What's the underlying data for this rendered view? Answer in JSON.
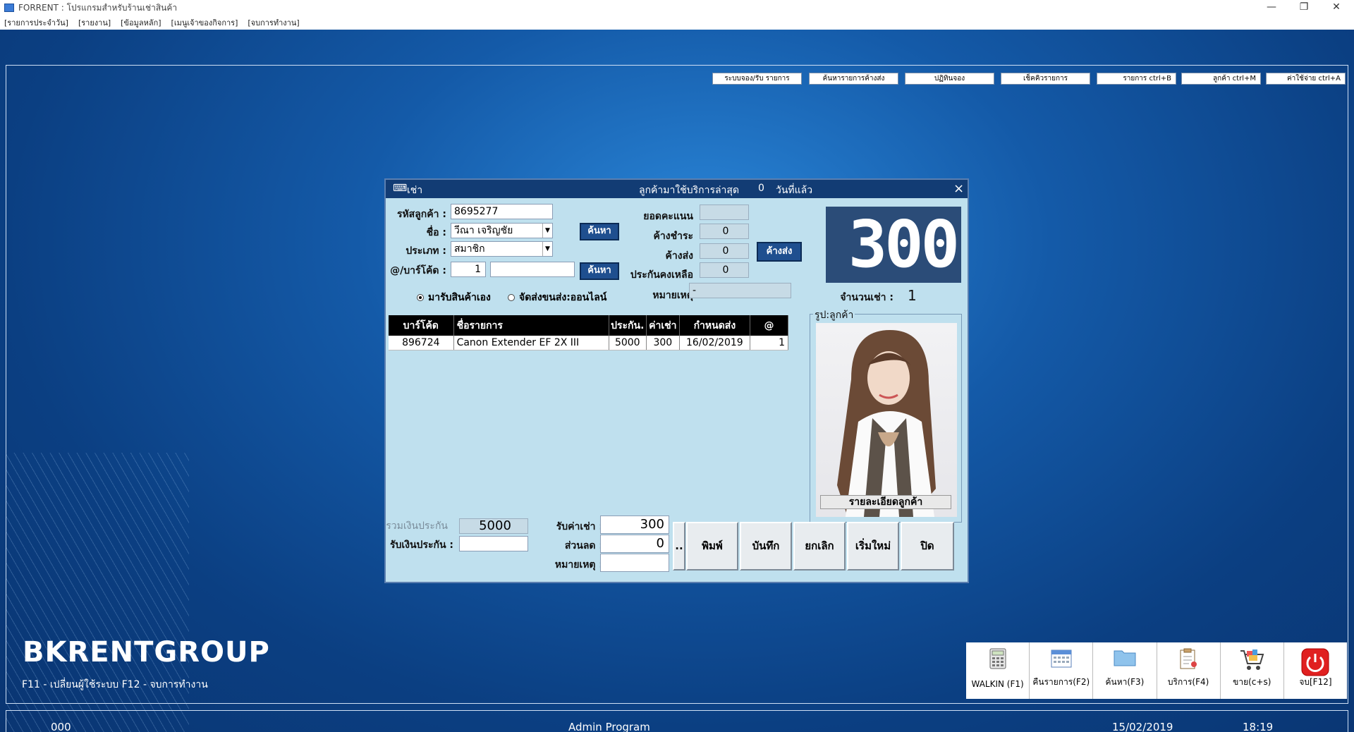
{
  "window": {
    "title": "FORRENT : โปรแกรมสำหรับร้านเช่าสินค้า",
    "minimize": "—",
    "restore": "❐",
    "close": "✕"
  },
  "menu": [
    "[รายการประจำวัน]",
    "[รายงาน]",
    "[ข้อมูลหลัก]",
    "[เมนูเจ้าของกิจการ]",
    "[จบการทำงาน]"
  ],
  "top_buttons": [
    "ระบบจอง/รับ รายการ",
    "ค้นหารายการค้างส่ง",
    "ปฏิทินจอง",
    "เช็คคิวรายการ",
    "รายการ ctrl+B",
    "ลูกค้า ctrl+M",
    "ค่าใช้จ่าย ctrl+A"
  ],
  "brand": {
    "name": "BKRENTGROUP",
    "hotkeys": "F11 - เปลี่ยนผู้ใช้ระบบ    F12 - จบการทำงาน"
  },
  "status": {
    "code": "000",
    "user": "Admin Program",
    "date": "15/02/2019",
    "time": "18:19"
  },
  "shortcuts": [
    {
      "label": "WALKIN  (F1)",
      "icon": "calculator-icon"
    },
    {
      "label": "คืนรายการ(F2)",
      "icon": "calendar-icon"
    },
    {
      "label": "ค้นหา(F3)",
      "icon": "folder-icon"
    },
    {
      "label": "บริการ(F4)",
      "icon": "clipboard-icon"
    },
    {
      "label": "ขาย(c+s)",
      "icon": "cart-icon"
    },
    {
      "label": "จบ[F12]",
      "icon": "power-icon"
    }
  ],
  "dialog": {
    "title": "เช่า",
    "last_visit_label": "ลูกค้ามาใช้บริการล่าสุด",
    "last_visit_days": "0",
    "days_ago_label": "วันที่แล้ว",
    "close": "×",
    "labels": {
      "customer_code": "รหัสลูกค้า :",
      "name": "ชื่อ :",
      "type": "ประเภท :",
      "barcode": "@/บาร์โค้ด :",
      "points": "ยอดคะแนน",
      "owed_payment": "ค้างชำระ",
      "owed_return": "ค้างส่ง",
      "deposit_left": "ประกันคงเหลือ",
      "note": "หมายเหตุ",
      "rent_count": "จำนวนเช่า :",
      "photo": "รูป:ลูกค้า",
      "total_deposit": "รวมเงินประกัน",
      "receive_deposit": "รับเงินประกัน :",
      "receive_rent": "รับค่าเช่า :",
      "discount": "ส่วนลด :",
      "note2": "หมายเหตุ :"
    },
    "values": {
      "customer_code": "8695277",
      "name": "วีณา  เจริญชัย",
      "type": "สมาชิก",
      "qty": "1",
      "barcode": "",
      "points": "",
      "owed_payment": "0",
      "owed_return": "0",
      "deposit_left": "0",
      "note": "-",
      "rent_count": "1",
      "big_total": "300",
      "total_deposit": "5000",
      "receive_deposit": "",
      "receive_rent": "300",
      "discount": "0",
      "note2": ""
    },
    "buttons": {
      "search1": "ค้นหา",
      "search2": "ค้นหา",
      "owed_return": "ค้างส่ง",
      "detail": "รายละเอียดลูกค้า",
      "dots": "..",
      "print": "พิมพ์",
      "save": "บันทึก",
      "cancel": "ยกเลิก",
      "restart": "เริ่มใหม่",
      "close": "ปิด"
    },
    "radios": [
      "มารับสินค้าเอง",
      "จัดส่งขนส่ง:ออนไลน์"
    ],
    "table": {
      "headers": [
        "บาร์โค้ด",
        "ชื่อรายการ",
        "ประกัน.",
        "ค่าเช่า",
        "กำหนดส่ง",
        "@"
      ],
      "rows": [
        [
          "896724",
          "Canon Extender EF 2X III",
          "5000",
          "300",
          "16/02/2019",
          "1"
        ]
      ]
    }
  }
}
